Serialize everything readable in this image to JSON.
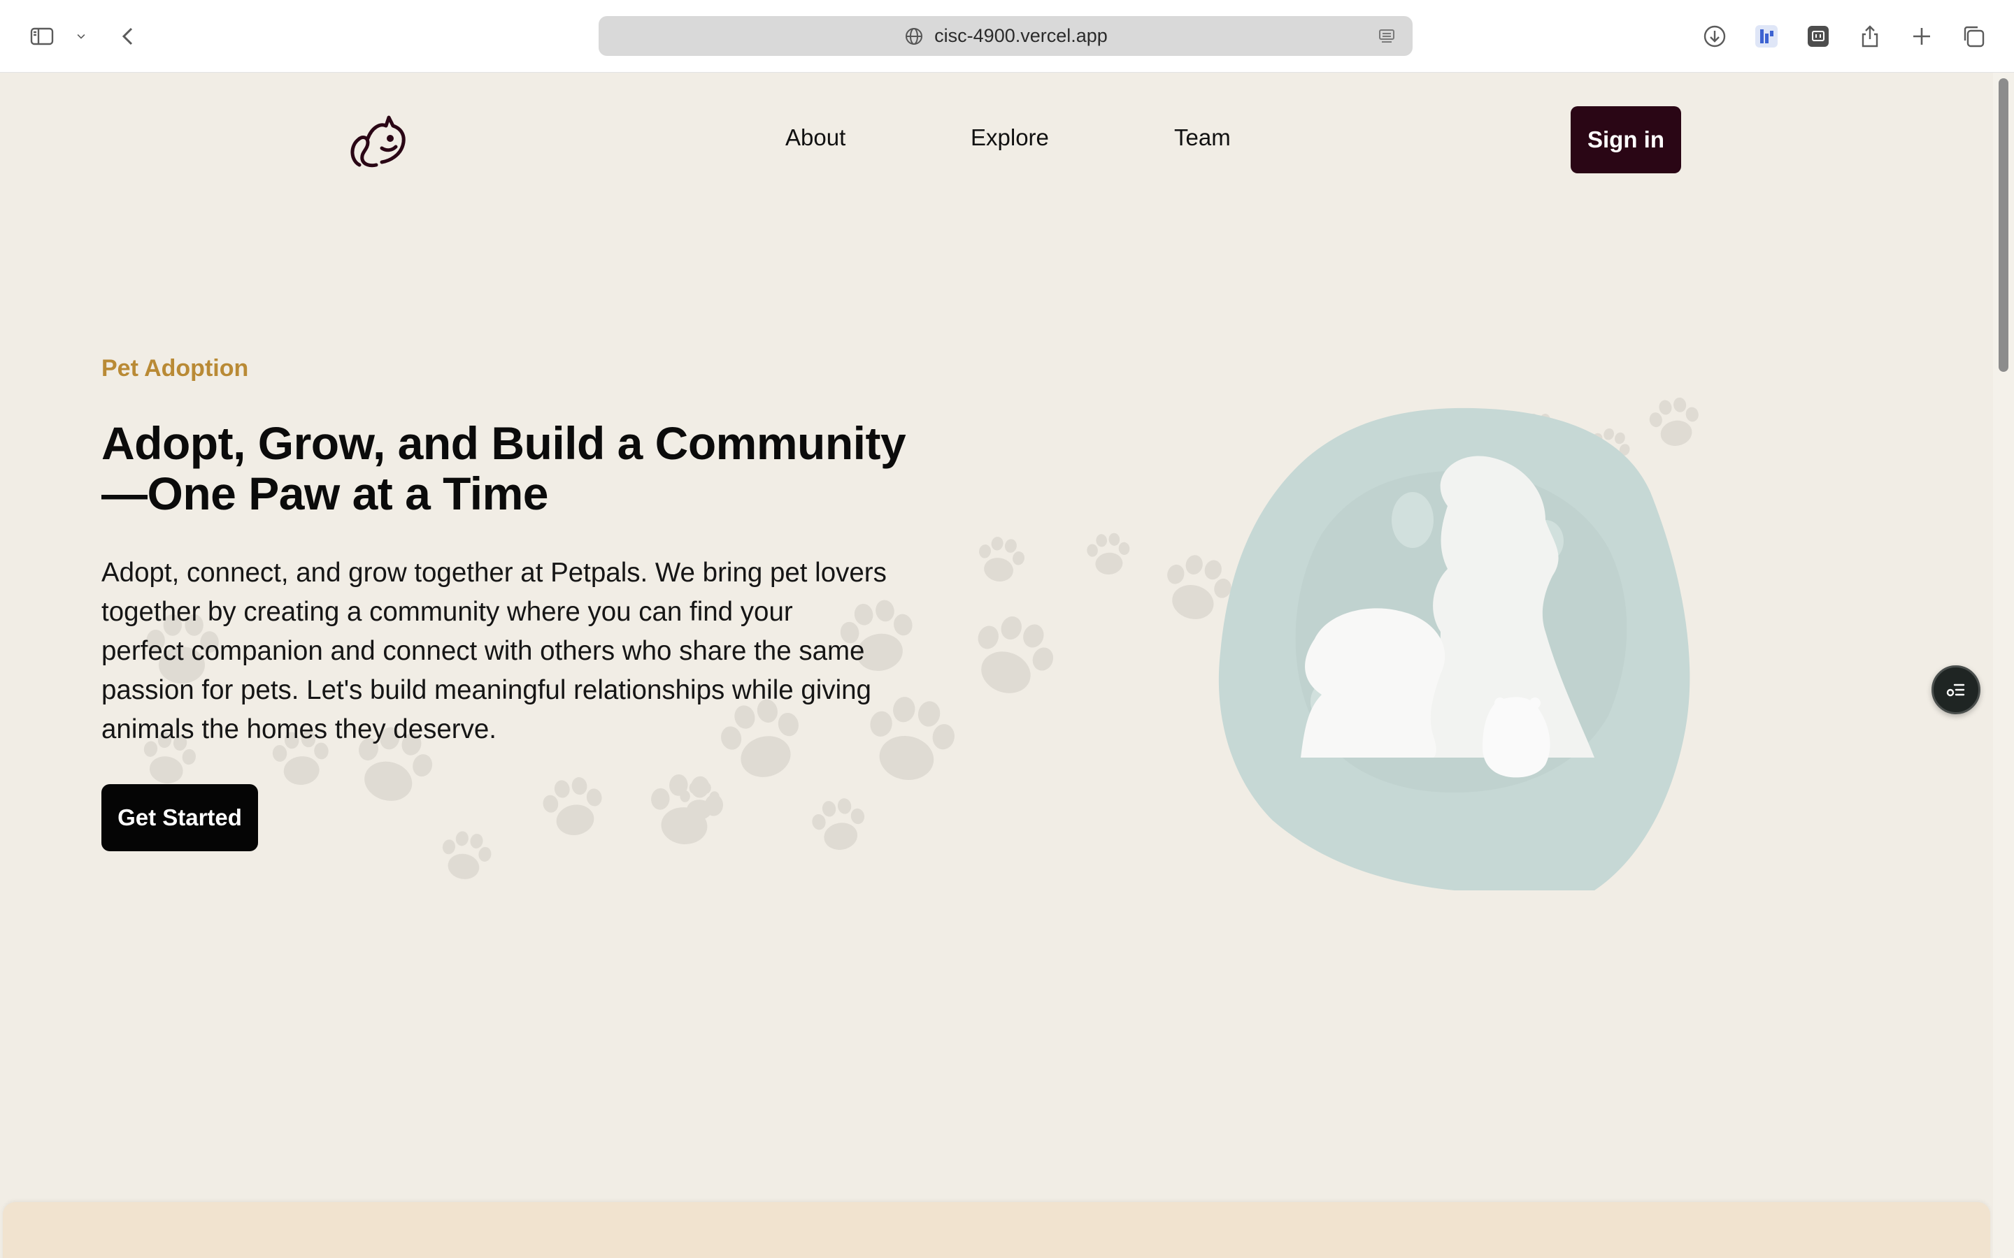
{
  "browser": {
    "url": "cisc-4900.vercel.app"
  },
  "nav": {
    "links": [
      "About",
      "Explore",
      "Team"
    ],
    "signin_label": "Sign in"
  },
  "hero": {
    "eyebrow": "Pet Adoption",
    "headline_line1": "Adopt, Grow, and Build a Community",
    "headline_line2": "—One Paw at a Time",
    "intro_lines": [
      "Adopt, connect, and grow together at Petpals. We bring pet lovers",
      "together by creating a community where you can find your",
      "perfect companion and connect with others who share the same",
      "passion for pets. Let's build meaningful relationships while giving",
      "animals the homes they deserve."
    ],
    "cta_label": "Get Started"
  },
  "colors": {
    "background": "#f1ede5",
    "accent": "#b98a35",
    "signin_bg": "#2a0615",
    "cta_bg": "#050505",
    "blob": "#c6d8d5"
  },
  "icons": {
    "sidebar": "sidebar-icon",
    "back": "back-chevron-icon",
    "download": "download-icon",
    "share": "share-icon",
    "new_tab": "plus-icon",
    "tabs": "tabs-overview-icon",
    "logo": "petpals-logo-icon",
    "floating": "list-menu-icon"
  }
}
